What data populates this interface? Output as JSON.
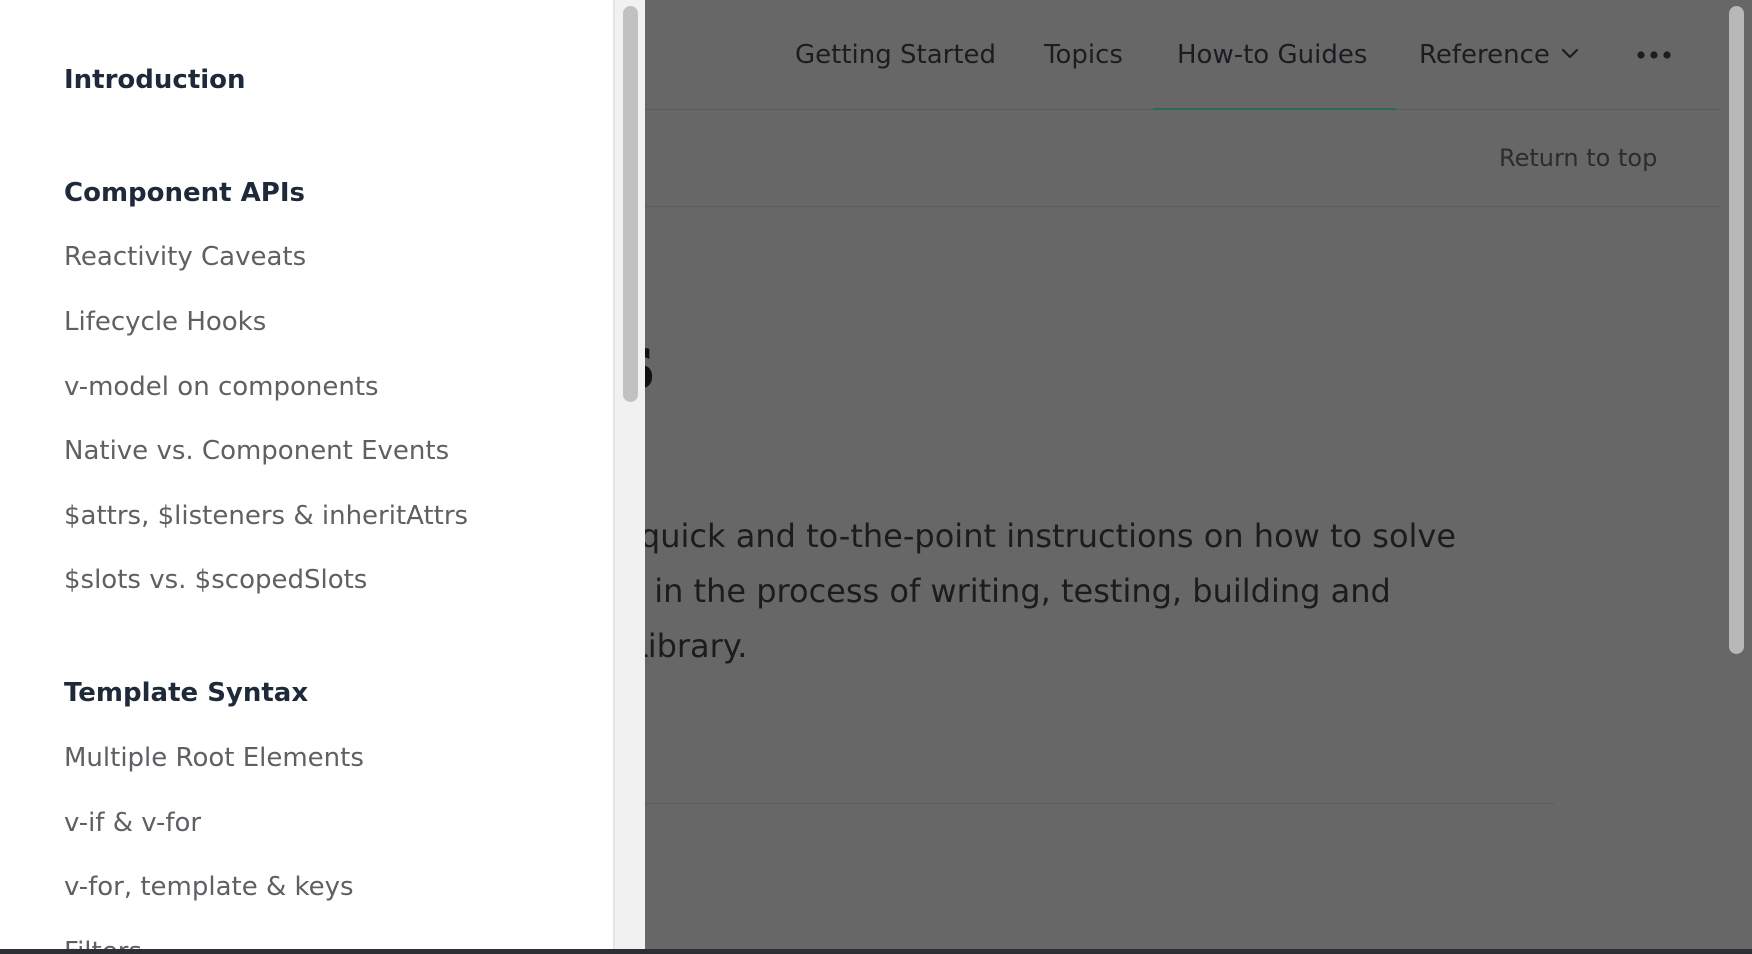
{
  "colors": {
    "overlay_background": "#676767",
    "sidebar_background": "#ffffff",
    "heading_text": "#1e2a3a",
    "link_text": "#5e6064",
    "active_tab_underline": "#2c6b52"
  },
  "topnav": {
    "items": [
      {
        "label": "Getting Started",
        "active": false
      },
      {
        "label": "Topics",
        "active": false
      },
      {
        "label": "How-to Guides",
        "active": true
      },
      {
        "label": "Reference",
        "active": false,
        "icon": "chevron-down-icon"
      }
    ],
    "more_icon": "more-horizontal-icon"
  },
  "subbar": {
    "return_to_top": "Return to top"
  },
  "main": {
    "title_visible": "es",
    "paragraph_lines": [
      "o be quick and to-the-point instructions on how to solve",
      " tasks in the process of writing, testing, building and",
      "Vue Library."
    ]
  },
  "sidebar": {
    "sections": [
      {
        "heading": "Introduction",
        "items": []
      },
      {
        "heading": "Component APIs",
        "items": [
          "Reactivity Caveats",
          "Lifecycle Hooks",
          "v-model on components",
          "Native vs. Component Events",
          "$attrs, $listeners & inheritAttrs",
          "$slots vs. $scopedSlots"
        ]
      },
      {
        "heading": "Template Syntax",
        "items": [
          "Multiple Root Elements",
          "v-if & v-for",
          "v-for, template & keys",
          "Filters"
        ]
      }
    ]
  }
}
